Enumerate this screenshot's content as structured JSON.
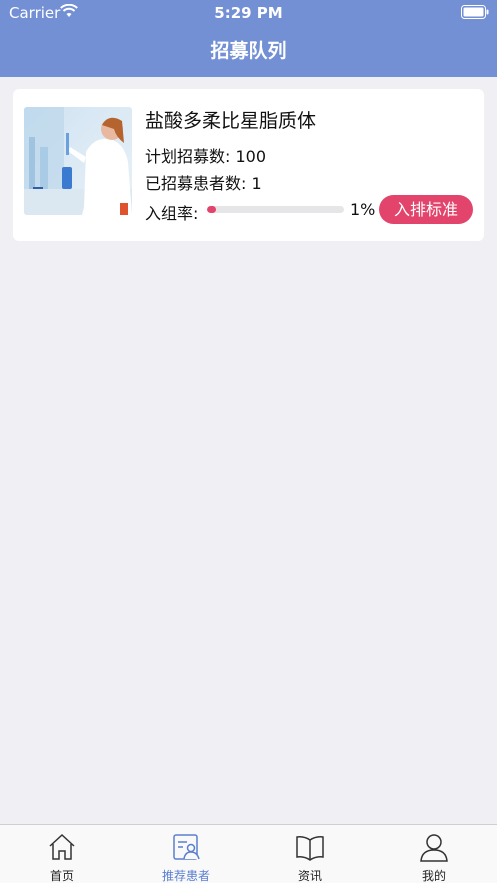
{
  "status_bar": {
    "carrier": "Carrier",
    "time": "5:29 PM"
  },
  "nav": {
    "title": "招募队列"
  },
  "study": {
    "image_icon": "lab-researcher-photo",
    "name": "盐酸多柔比星脂质体",
    "plan_text": "计划招募数: 100",
    "recruited_text": "已招募患者数: 1",
    "rate_label": "入组率:",
    "rate_value": "1%",
    "rate_fraction": 0.01,
    "criteria_button": "入排标准"
  },
  "tabbar": {
    "tabs": [
      {
        "label": "首页",
        "icon": "home-icon",
        "active": false
      },
      {
        "label": "推荐患者",
        "icon": "recommend-patient-icon",
        "active": true
      },
      {
        "label": "资讯",
        "icon": "book-icon",
        "active": false
      },
      {
        "label": "我的",
        "icon": "person-icon",
        "active": false
      }
    ]
  },
  "colors": {
    "header": "#7390d5",
    "accent": "#e2446b",
    "tab_active": "#5a7fd0",
    "background": "#efeff4"
  }
}
